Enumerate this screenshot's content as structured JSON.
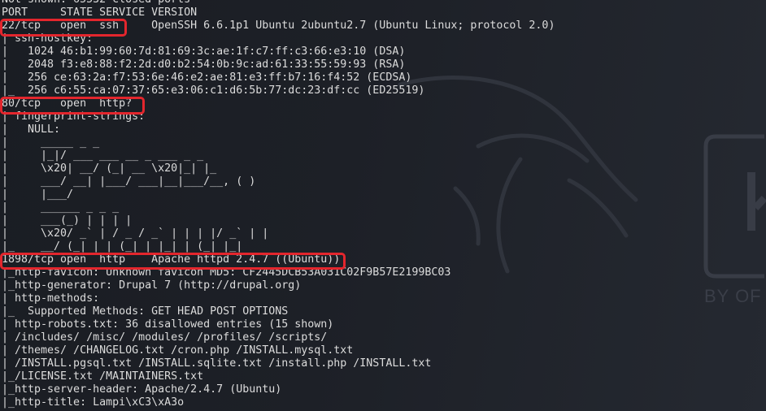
{
  "colors": {
    "background": "#1d2027",
    "text": "#dcdcdc",
    "highlight": "#e3262d"
  },
  "wallpaper": {
    "logo_text": "BY OF"
  },
  "scan": {
    "summary": "Not shown: 65532 closed ports",
    "header": {
      "port": "PORT",
      "state": "STATE",
      "service": "SERVICE",
      "version": "VERSION"
    },
    "ports": [
      {
        "port": "22/tcp",
        "state": "open",
        "service": "ssh",
        "version": "OpenSSH 6.6.1p1 Ubuntu 2ubuntu2.7 (Ubuntu Linux; protocol 2.0)",
        "script_output": [
          "| ssh-hostkey: ",
          "|   1024 46:b1:99:60:7d:81:69:3c:ae:1f:c7:ff:c3:66:e3:10 (DSA)",
          "|   2048 f3:e8:88:f2:2d:d0:b2:54:0b:9c:ad:61:33:55:59:93 (RSA)",
          "|   256 ce:63:2a:f7:53:6e:46:e2:ae:81:e3:ff:b7:16:f4:52 (ECDSA)",
          "|_  256 c6:55:ca:07:37:65:e3:06:c1:d6:5b:77:dc:23:df:cc (ED25519)"
        ]
      },
      {
        "port": "80/tcp",
        "state": "open",
        "service": "http?",
        "script_output": [
          "| fingerprint-strings: ",
          "|   NULL: ",
          "|     _____ _ _ ",
          "|     |_|/ ___ ___ __ _ ___ _ _ ",
          "|     \\x20| __/ (_| __ \\x20|_| |_ ",
          "|     ___/ __| |___/ ___|__|___/__, ( ) ",
          "|     |___/ ",
          "|     ______ _ _ _ ",
          "|     ___(_) | | | | ",
          "|     \\x20/ _` | / _ / _` | | | |/ _` | | ",
          "|_    __/ (_| | | (_| | |_| | (_| |_|"
        ]
      },
      {
        "port": "1898/tcp",
        "state": "open",
        "service": "http",
        "version": "Apache httpd 2.4.7 ((Ubuntu))",
        "script_output": [
          "|_http-favicon: Unknown favicon MD5: CF2445DCB53A031C02F9B57E2199BC03",
          "|_http-generator: Drupal 7 (http://drupal.org)",
          "| http-methods: ",
          "|_  Supported Methods: GET HEAD POST OPTIONS",
          "| http-robots.txt: 36 disallowed entries (15 shown)",
          "| /includes/ /misc/ /modules/ /profiles/ /scripts/ ",
          "| /themes/ /CHANGELOG.txt /cron.php /INSTALL.mysql.txt ",
          "| /INSTALL.pgsql.txt /INSTALL.sqlite.txt /install.php /INSTALL.txt ",
          "|_/LICENSE.txt /MAINTAINERS.txt",
          "|_http-server-header: Apache/2.4.7 (Ubuntu)",
          "|_http-title: Lampi\\xC3\\xA3o"
        ]
      }
    ]
  }
}
